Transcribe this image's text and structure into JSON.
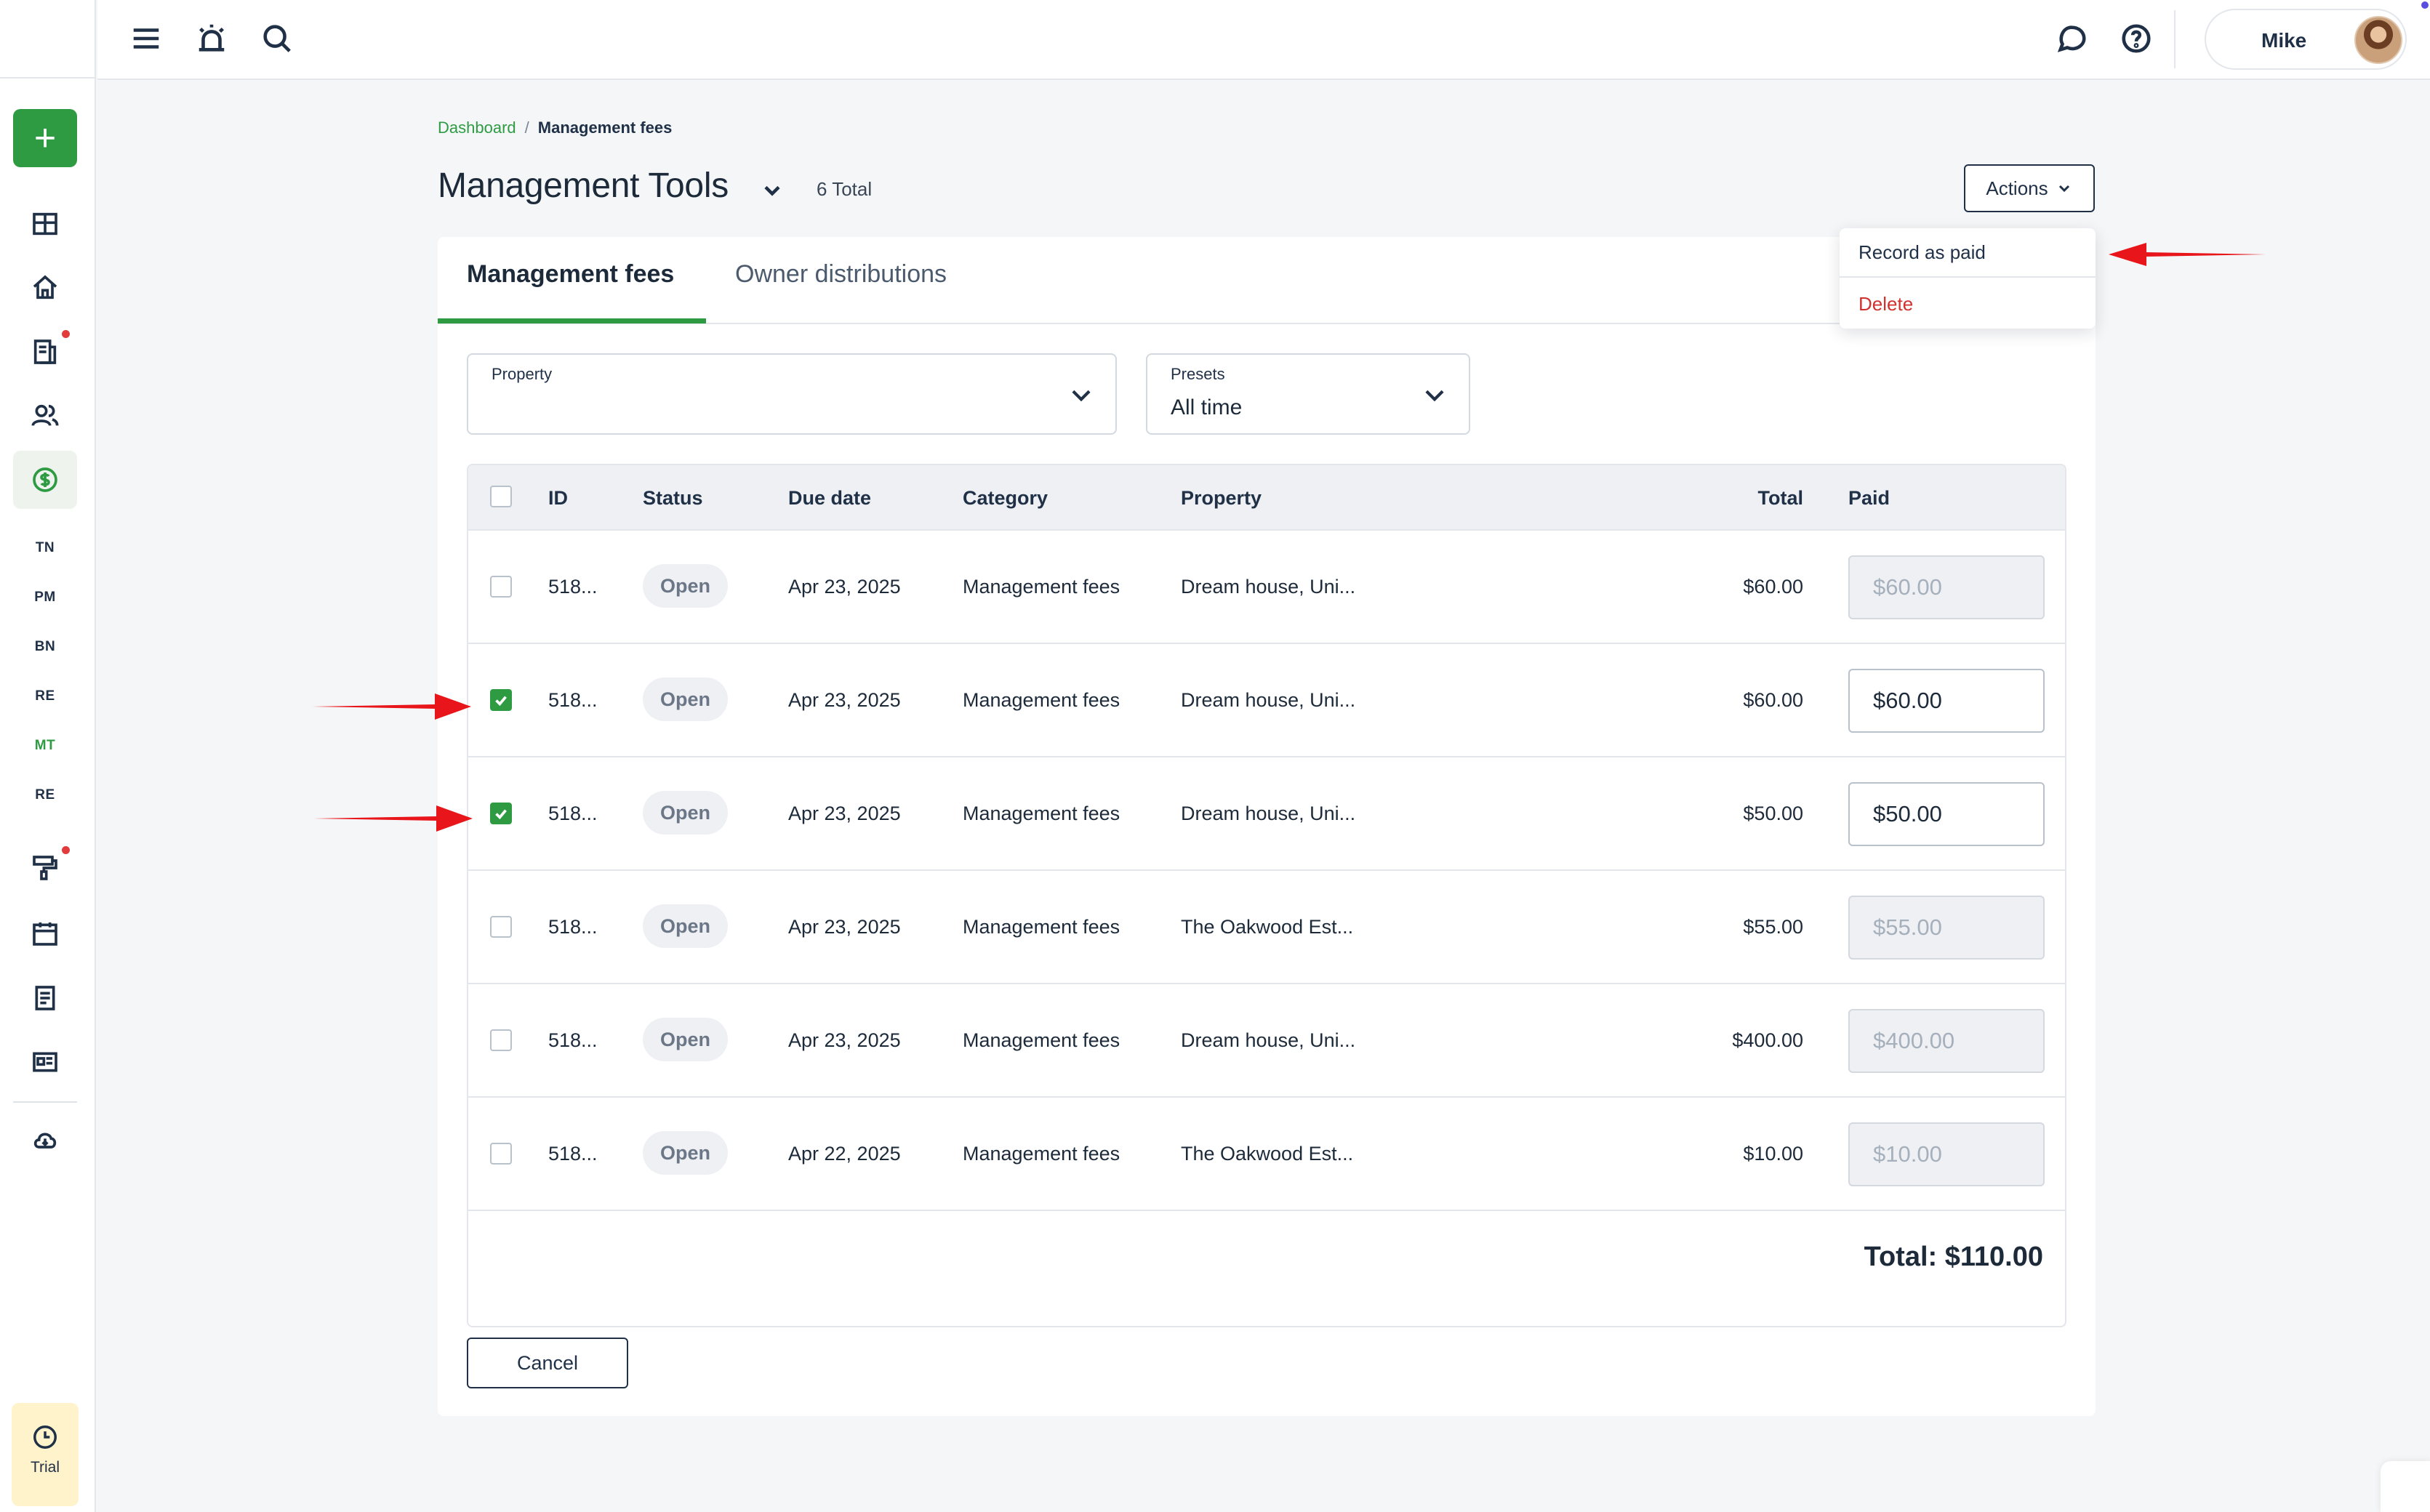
{
  "sidebar": {
    "abbreviations": [
      "TN",
      "PM",
      "BN",
      "RE",
      "MT",
      "RE"
    ],
    "trial_label": "Trial"
  },
  "topbar": {
    "user_name": "Mike"
  },
  "breadcrumb": {
    "link": "Dashboard",
    "separator": "/",
    "current": "Management fees"
  },
  "header": {
    "title": "Management Tools",
    "total": "6 Total",
    "actions_label": "Actions"
  },
  "actions_menu": {
    "items": [
      "Record as paid",
      "Delete"
    ]
  },
  "tabs": [
    {
      "label": "Management fees",
      "active": true
    },
    {
      "label": "Owner distributions",
      "active": false
    }
  ],
  "filters": {
    "property": {
      "label": "Property",
      "value": ""
    },
    "presets": {
      "label": "Presets",
      "value": "All time"
    }
  },
  "table": {
    "columns": [
      "ID",
      "Status",
      "Due date",
      "Category",
      "Property",
      "Total",
      "Paid"
    ],
    "rows": [
      {
        "id": "518...",
        "status": "Open",
        "due": "Apr 23, 2025",
        "category": "Management fees",
        "property": "Dream house, Uni...",
        "total": "$60.00",
        "paid": "$60.00",
        "checked": false
      },
      {
        "id": "518...",
        "status": "Open",
        "due": "Apr 23, 2025",
        "category": "Management fees",
        "property": "Dream house, Uni...",
        "total": "$60.00",
        "paid": "$60.00",
        "checked": true
      },
      {
        "id": "518...",
        "status": "Open",
        "due": "Apr 23, 2025",
        "category": "Management fees",
        "property": "Dream house, Uni...",
        "total": "$50.00",
        "paid": "$50.00",
        "checked": true
      },
      {
        "id": "518...",
        "status": "Open",
        "due": "Apr 23, 2025",
        "category": "Management fees",
        "property": "The Oakwood Est...",
        "total": "$55.00",
        "paid": "$55.00",
        "checked": false
      },
      {
        "id": "518...",
        "status": "Open",
        "due": "Apr 23, 2025",
        "category": "Management fees",
        "property": "Dream house, Uni...",
        "total": "$400.00",
        "paid": "$400.00",
        "checked": false
      },
      {
        "id": "518...",
        "status": "Open",
        "due": "Apr 22, 2025",
        "category": "Management fees",
        "property": "The Oakwood Est...",
        "total": "$10.00",
        "paid": "$10.00",
        "checked": false
      }
    ],
    "grand_total": "Total: $110.00"
  },
  "footer": {
    "cancel_label": "Cancel"
  },
  "colors": {
    "accent": "#2e9b43",
    "danger": "#d0332f",
    "annotation_arrow": "#e8151b"
  }
}
